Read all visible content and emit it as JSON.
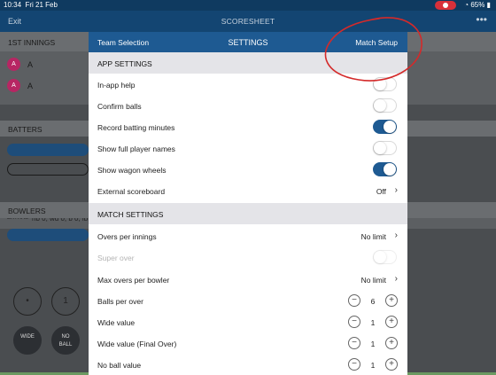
{
  "status_bar": {
    "time": "10:34",
    "date": "Fri 21 Feb",
    "battery": "65%"
  },
  "app_bar": {
    "exit": "Exit",
    "title": "SCORESHEET",
    "more": "•••"
  },
  "background": {
    "innings_label": "1ST INNINGS",
    "players": [
      "A",
      "A"
    ],
    "batters_label": "BATTERS",
    "extras_label": "EXTRAS",
    "extras_value": "nb 0, wd 0, b 0, lb 0",
    "bowlers_label": "BOWLERS",
    "balls": [
      "•",
      "1"
    ],
    "bottom_buttons": [
      {
        "l1": "WIDE",
        "l2": ""
      },
      {
        "l1": "NO",
        "l2": "BALL"
      }
    ]
  },
  "modal": {
    "header": {
      "left": "Team Selection",
      "title": "SETTINGS",
      "right": "Match Setup"
    },
    "app_settings": {
      "title": "APP SETTINGS",
      "rows": [
        {
          "label": "In-app help",
          "on": false
        },
        {
          "label": "Confirm balls",
          "on": false
        },
        {
          "label": "Record batting minutes",
          "on": true
        },
        {
          "label": "Show full player names",
          "on": false
        },
        {
          "label": "Show wagon wheels",
          "on": true
        }
      ],
      "external_scoreboard": {
        "label": "External scoreboard",
        "value": "Off"
      }
    },
    "match_settings": {
      "title": "MATCH SETTINGS",
      "overs_per_innings": {
        "label": "Overs per innings",
        "value": "No limit"
      },
      "super_over": {
        "label": "Super over",
        "on": false,
        "enabled": false
      },
      "max_overs_per_bowler": {
        "label": "Max overs per bowler",
        "value": "No limit"
      },
      "steppers": [
        {
          "label": "Balls per over",
          "value": "6"
        },
        {
          "label": "Wide value",
          "value": "1"
        },
        {
          "label": "Wide value (Final Over)",
          "value": "1"
        },
        {
          "label": "No ball value",
          "value": "1"
        }
      ]
    }
  },
  "icons": {
    "chevron": "chevron-right-icon",
    "minus": "minus-circle-icon",
    "plus": "plus-circle-icon"
  },
  "colors": {
    "header": "#1e5a92",
    "toggle_on": "#1e5a92",
    "avatar": "#b72663",
    "annotation": "#d42a2a"
  }
}
